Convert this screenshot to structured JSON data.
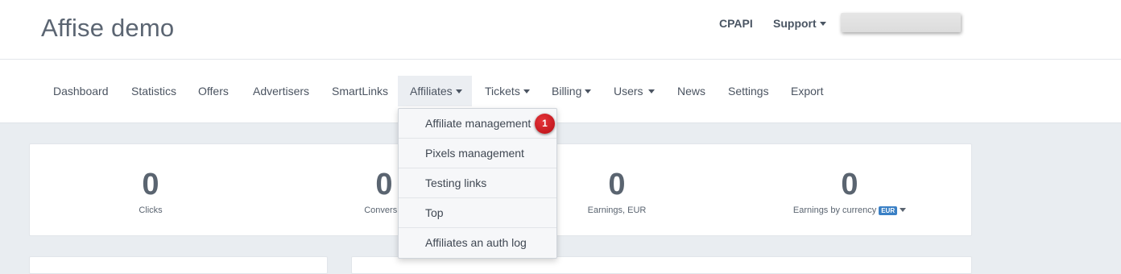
{
  "header": {
    "title": "Affise demo",
    "links": {
      "cpapi": "CPAPI",
      "support": "Support"
    }
  },
  "nav": {
    "items": [
      "Dashboard",
      "Statistics",
      "Offers",
      "Advertisers",
      "SmartLinks",
      "Affiliates",
      "Tickets",
      "Billing",
      "Users",
      "News",
      "Settings",
      "Export"
    ],
    "active": "Affiliates"
  },
  "dropdown": {
    "items": [
      "Affiliate management",
      "Pixels management",
      "Testing links",
      "Top",
      "Affiliates an auth log"
    ],
    "step_badge": "1"
  },
  "stats": [
    {
      "value": "0",
      "label": "Clicks"
    },
    {
      "value": "0",
      "label": "Conversio"
    },
    {
      "value": "0",
      "label": "Earnings, EUR"
    },
    {
      "value": "0",
      "label": "Earnings by currency",
      "badge": "EUR"
    }
  ],
  "colors": {
    "accent_badge": "#3a80c5",
    "step_badge": "#d21f26",
    "page_background": "#e9edf1"
  }
}
